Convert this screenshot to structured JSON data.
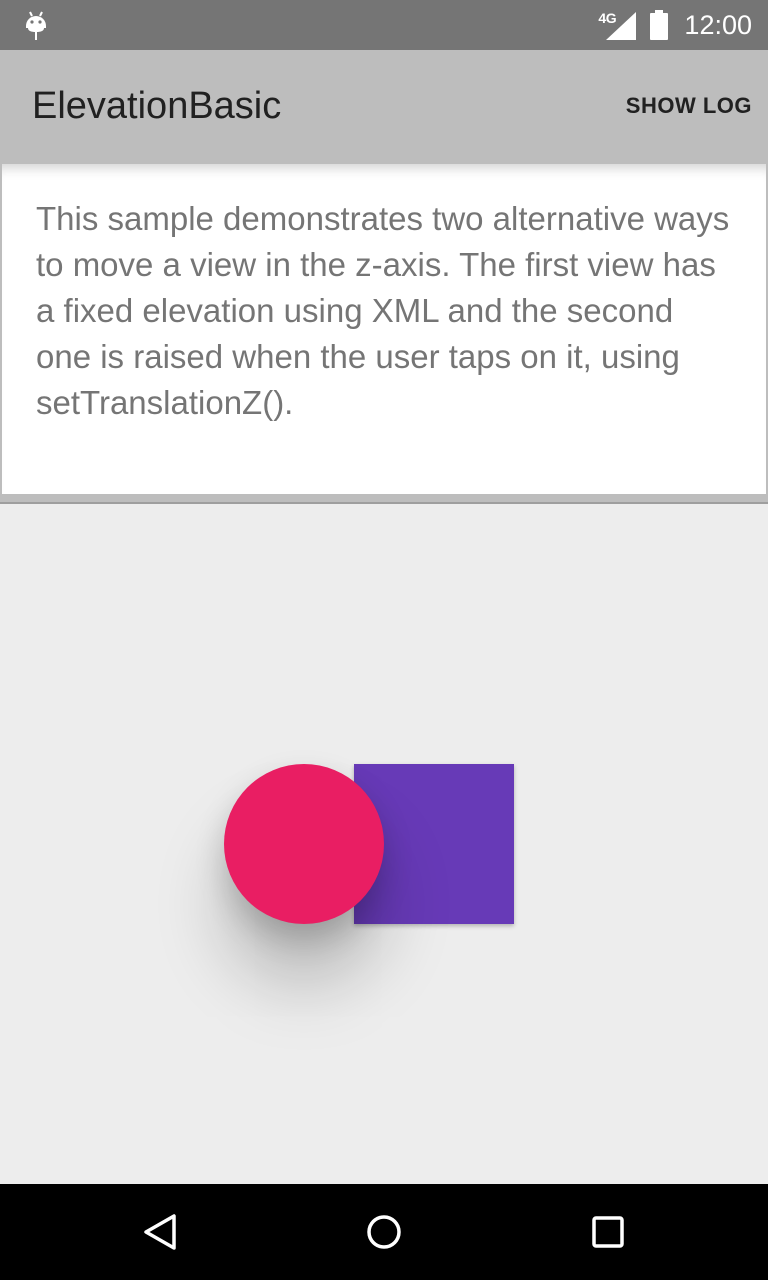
{
  "status_bar": {
    "network_label": "4G",
    "time": "12:00",
    "icons": [
      "android-debug-icon",
      "signal-icon",
      "battery-icon"
    ]
  },
  "app_bar": {
    "title": "ElevationBasic",
    "action_label": "SHOW LOG"
  },
  "intro": {
    "text": "This sample demonstrates two alternative ways to move a view in the z-axis. The first view has a fixed elevation using XML and the second one is raised when the user taps on it, using setTranslationZ()."
  },
  "content": {
    "shapes": [
      {
        "name": "floating-square",
        "shape": "square",
        "color": "#673ab7"
      },
      {
        "name": "raised-circle",
        "shape": "circle",
        "color": "#e91e63"
      }
    ]
  },
  "nav_bar": {
    "icons": [
      "back-icon",
      "home-icon",
      "recents-icon"
    ]
  },
  "colors": {
    "status_bar": "#757575",
    "app_bar": "#bdbdbd",
    "background": "#ededed",
    "purple": "#673ab7",
    "pink": "#e91e63"
  }
}
